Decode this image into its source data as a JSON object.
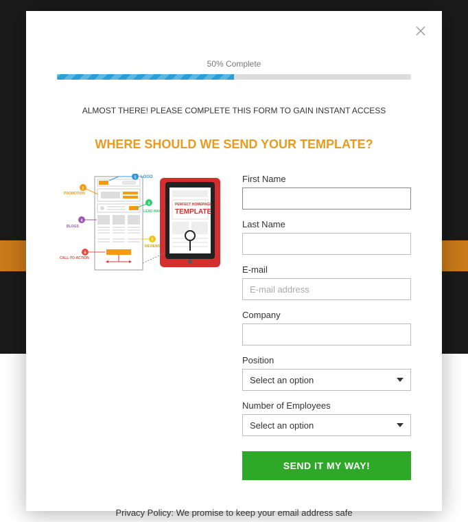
{
  "progress": {
    "label": "50% Complete",
    "percent": 50
  },
  "subheading": "ALMOST THERE! PLEASE COMPLETE THIS FORM TO GAIN INSTANT ACCESS",
  "heading": "WHERE SHOULD WE SEND YOUR TEMPLATE?",
  "illustration": {
    "labels": {
      "logo": "LOGO",
      "promotion": "PROMOTION",
      "lead_magnet": "LEAD MAGNET",
      "blogs": "BLOGS",
      "reviews": "REVIEWS",
      "cta": "CALL-TO-ACTION"
    },
    "tablet_text_line1": "PERFECT HOMEPAGE",
    "tablet_text_line2": "TEMPLATE"
  },
  "form": {
    "first_name_label": "First Name",
    "first_name_value": "",
    "last_name_label": "Last Name",
    "last_name_value": "",
    "email_label": "E-mail",
    "email_placeholder": "E-mail address",
    "email_value": "",
    "company_label": "Company",
    "company_value": "",
    "position_label": "Position",
    "position_selected": "Select an option",
    "employees_label": "Number of Employees",
    "employees_selected": "Select an option",
    "submit_label": "SEND IT MY WAY!"
  },
  "privacy": "Privacy Policy: We promise to keep your email address safe"
}
